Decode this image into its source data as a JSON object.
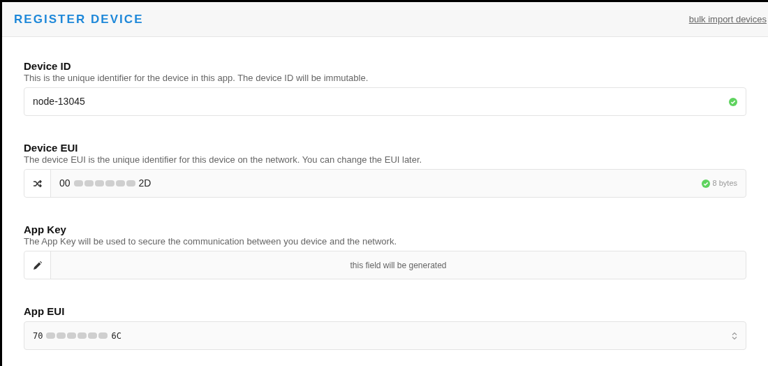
{
  "header": {
    "title": "REGISTER DEVICE",
    "link": "bulk import devices"
  },
  "fields": [
    {
      "kind": "text",
      "label": "Device ID",
      "description": "This is the unique identifier for the device in this app. The device ID will be immutable.",
      "value": "node-13045",
      "valid": true
    },
    {
      "kind": "redacted",
      "label": "Device EUI",
      "description": "The device EUI is the unique identifier for this device on the network. You can change the EUI later.",
      "value_start": "00",
      "value_end": "2D",
      "valid": true,
      "hint": "8 bytes"
    },
    {
      "kind": "generated",
      "label": "App Key",
      "description": "The App Key will be used to secure the communication between you device and the network.",
      "placeholder": "this field will be generated"
    },
    {
      "kind": "select",
      "label": "App EUI",
      "value_start": "70",
      "value_end": "6C"
    }
  ]
}
